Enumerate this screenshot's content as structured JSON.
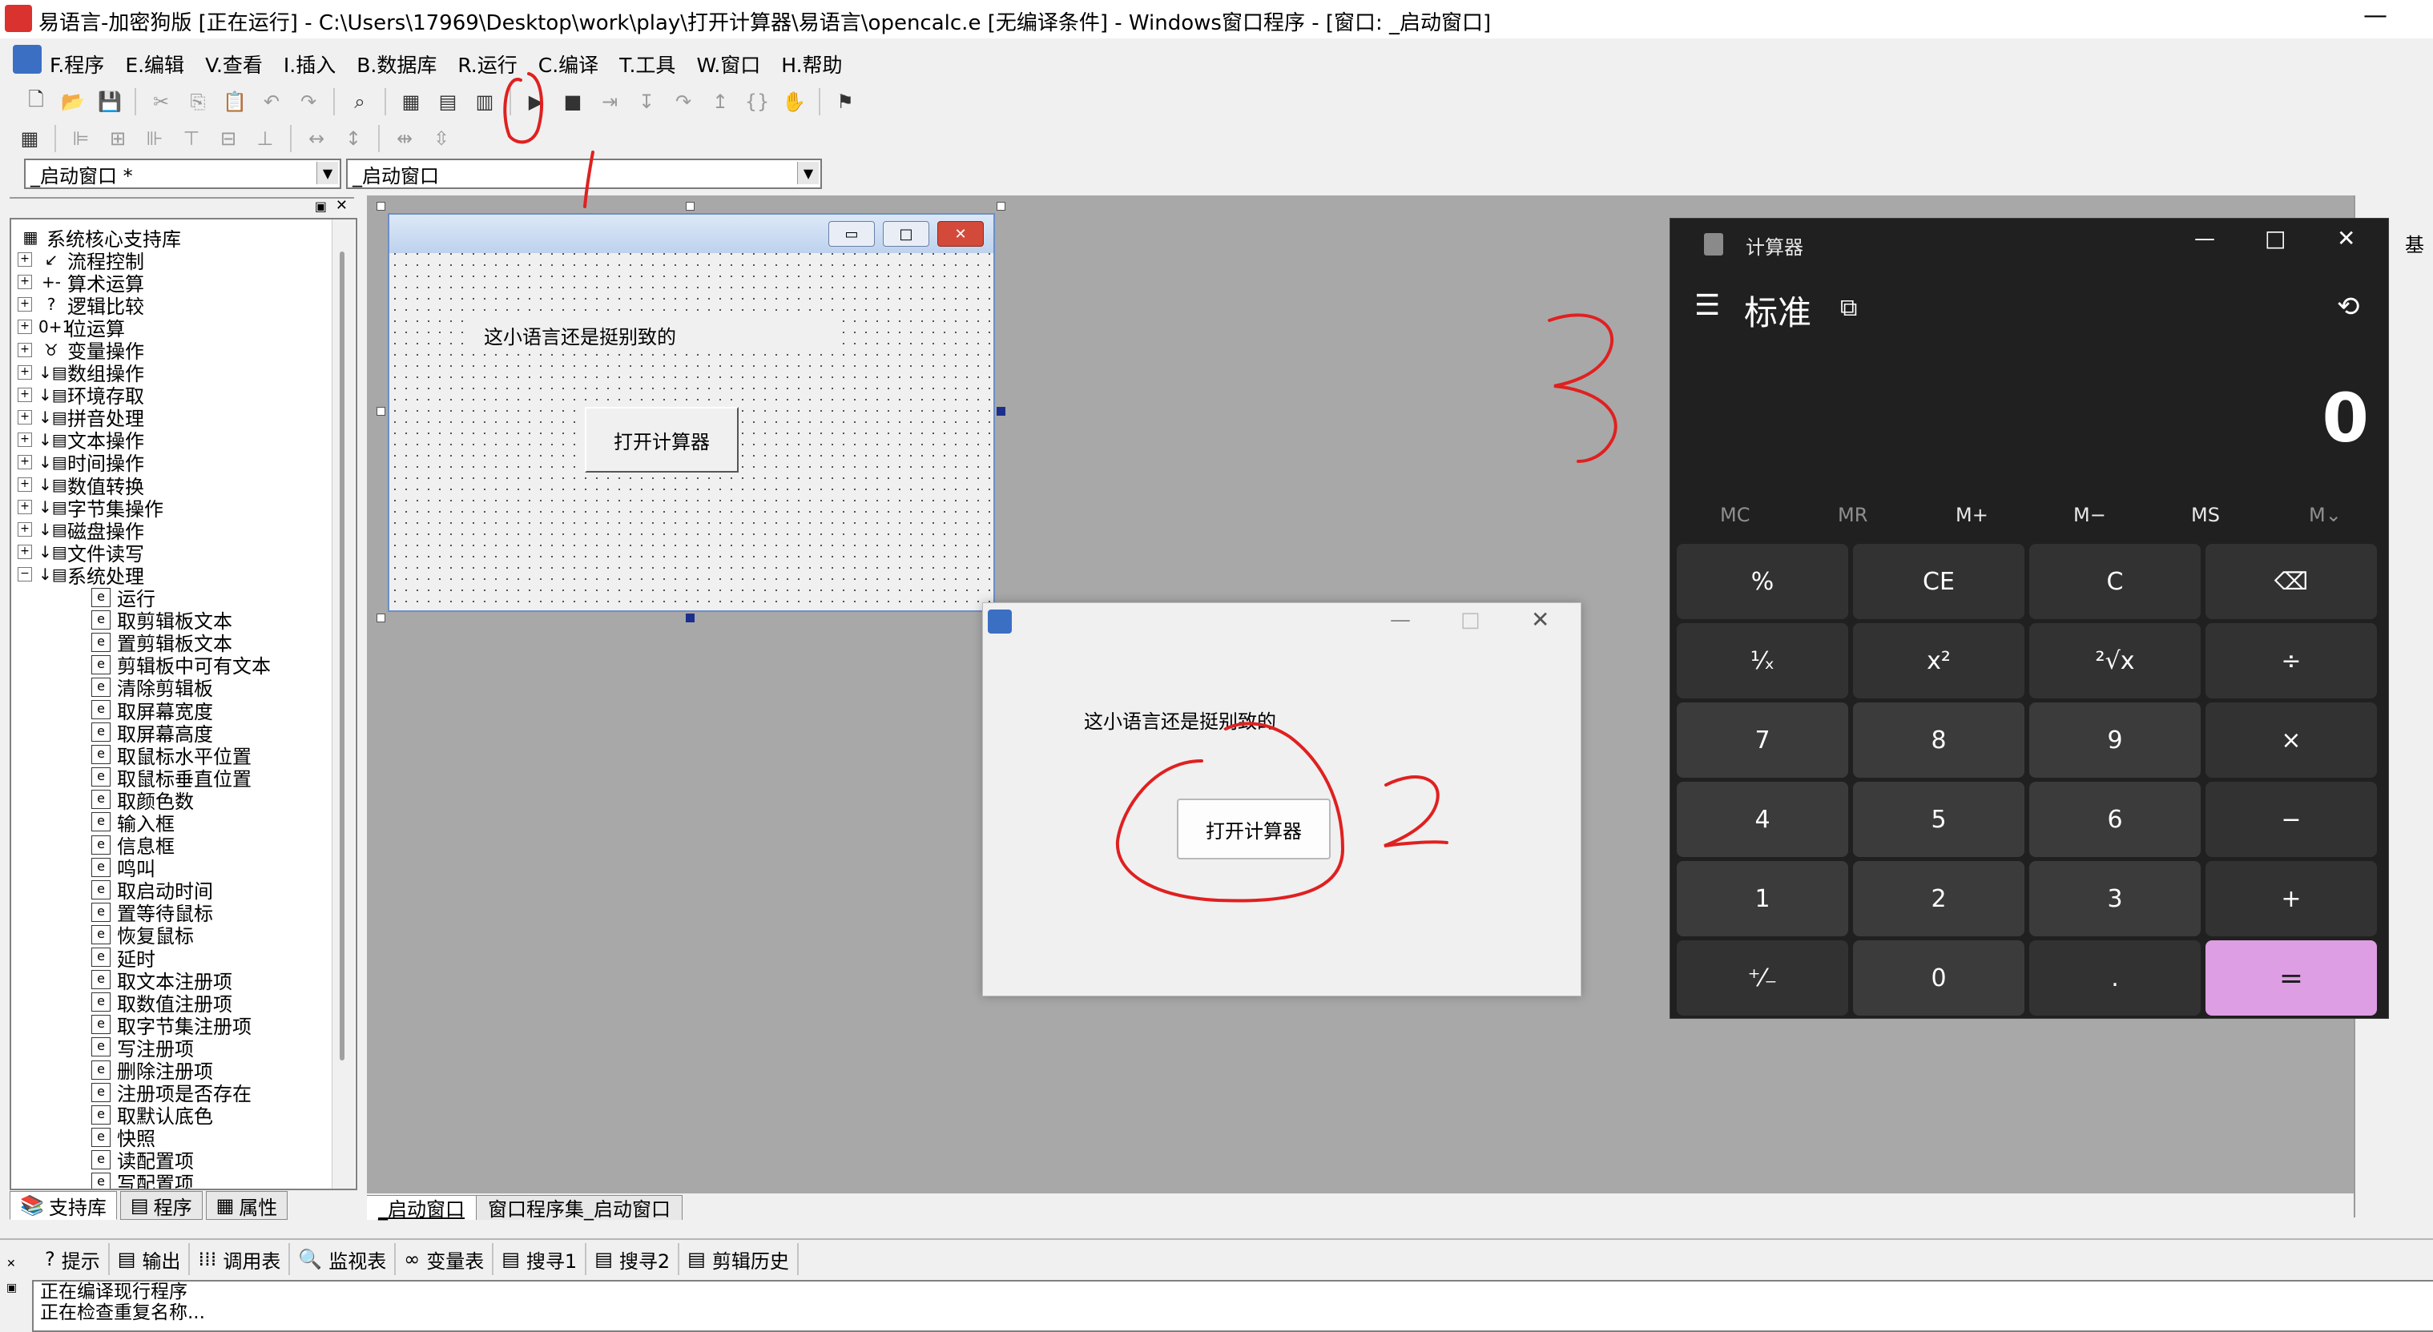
{
  "window": {
    "title": "易语言-加密狗版 [正在运行] - C:\\Users\\17969\\Desktop\\work\\play\\打开计算器\\易语言\\opencalc.e [无编译条件] - Windows窗口程序 - [窗口: _启动窗口]",
    "minimize_glyph": "—"
  },
  "menu": {
    "items": [
      "F.程序",
      "E.编辑",
      "V.查看",
      "I.插入",
      "B.数据库",
      "R.运行",
      "C.编译",
      "T.工具",
      "W.窗口",
      "H.帮助"
    ]
  },
  "toolbar": {
    "row1_icons": [
      "new-file-icon",
      "open-folder-icon",
      "save-icon",
      "sep",
      "cut-icon",
      "copy-icon",
      "paste-icon",
      "undo-icon",
      "redo-icon",
      "sep",
      "find-icon",
      "sep",
      "layout1-icon",
      "layout2-icon",
      "layout3-icon",
      "sep",
      "run-icon",
      "stop-icon",
      "step-icon",
      "step-into-icon",
      "step-over-icon",
      "step-out-icon",
      "braces-icon",
      "hand-icon",
      "sep",
      "debug-icon"
    ],
    "row2_icons": [
      "calc-icon",
      "sep",
      "align-left-icon",
      "align-center-icon",
      "align-right-icon",
      "align-top-icon",
      "align-middle-icon",
      "align-bottom-icon",
      "sep",
      "same-width-icon",
      "same-height-icon",
      "sep",
      "space-h-icon",
      "space-v-icon"
    ]
  },
  "combos": {
    "left": "_启动窗口 *",
    "right": "_启动窗口"
  },
  "support_lib": {
    "root": "系统核心支持库",
    "categories": [
      "流程控制",
      "算术运算",
      "逻辑比较",
      "位运算",
      "变量操作",
      "数组操作",
      "环境存取",
      "拼音处理",
      "文本操作",
      "时间操作",
      "数值转换",
      "字节集操作",
      "磁盘操作",
      "文件读写",
      "系统处理"
    ],
    "category_glyphs": [
      "↙",
      "+-",
      "?",
      "0+1",
      "♉",
      "↓▤",
      "↓▤",
      "↓▤",
      "↓▤",
      "↓▤",
      "↓▤",
      "↓▤",
      "↓▤",
      "↓▤",
      "↓▤"
    ],
    "leaves": [
      "运行",
      "取剪辑板文本",
      "置剪辑板文本",
      "剪辑板中可有文本",
      "清除剪辑板",
      "取屏幕宽度",
      "取屏幕高度",
      "取鼠标水平位置",
      "取鼠标垂直位置",
      "取颜色数",
      "输入框",
      "信息框",
      "鸣叫",
      "取启动时间",
      "置等待鼠标",
      "恢复鼠标",
      "延时",
      "取文本注册项",
      "取数值注册项",
      "取字节集注册项",
      "写注册项",
      "删除注册项",
      "注册项是否存在",
      "取默认底色",
      "快照",
      "读配置项",
      "写配置项"
    ]
  },
  "left_tabs": [
    "支持库",
    "程序",
    "属性"
  ],
  "designer": {
    "label": "这小语言还是挺别致的",
    "button": "打开计算器",
    "min_glyph": "▭",
    "max_glyph": "□",
    "close_glyph": "✕"
  },
  "popup": {
    "label": "这小语言还是挺别致的",
    "button": "打开计算器",
    "min_glyph": "—",
    "max_glyph": "□",
    "close_glyph": "✕"
  },
  "calculator": {
    "title": "计算器",
    "mode": "标准",
    "display": "0",
    "memory": [
      "MC",
      "MR",
      "M+",
      "M−",
      "MS",
      "M⌄"
    ],
    "keys": [
      [
        "%",
        "CE",
        "C",
        "⌫"
      ],
      [
        "¹⁄ₓ",
        "x²",
        "²√x",
        "÷"
      ],
      [
        "7",
        "8",
        "9",
        "×"
      ],
      [
        "4",
        "5",
        "6",
        "−"
      ],
      [
        "1",
        "2",
        "3",
        "+"
      ],
      [
        "⁺⁄₋",
        "0",
        ".",
        "="
      ]
    ],
    "eq_color": "#dd9ee3",
    "menu_glyph": "☰",
    "keep_glyph": "⧉",
    "history_glyph": "⟲",
    "min_glyph": "—",
    "max_glyph": "□",
    "close_glyph": "✕"
  },
  "doc_tabs": [
    "_启动窗口",
    "窗口程序集_启动窗口"
  ],
  "output_tabs": [
    {
      "icon": "hint-icon",
      "glyph": "?",
      "label": "提示"
    },
    {
      "icon": "output-icon",
      "glyph": "▤",
      "label": "输出"
    },
    {
      "icon": "callstack-icon",
      "glyph": "⁞⁞⁞",
      "label": "调用表"
    },
    {
      "icon": "watch-icon",
      "glyph": "🔍",
      "label": "监视表"
    },
    {
      "icon": "vars-icon",
      "glyph": "∞",
      "label": "变量表"
    },
    {
      "icon": "search1-icon",
      "glyph": "▤",
      "label": "搜寻1"
    },
    {
      "icon": "search2-icon",
      "glyph": "▤",
      "label": "搜寻2"
    },
    {
      "icon": "clip-history-icon",
      "glyph": "▤",
      "label": "剪辑历史"
    }
  ],
  "output_lines": [
    "正在编译现行程序",
    "正在检查重复名称..."
  ],
  "right_strip_label": "基",
  "annotation_color": "#e02020"
}
